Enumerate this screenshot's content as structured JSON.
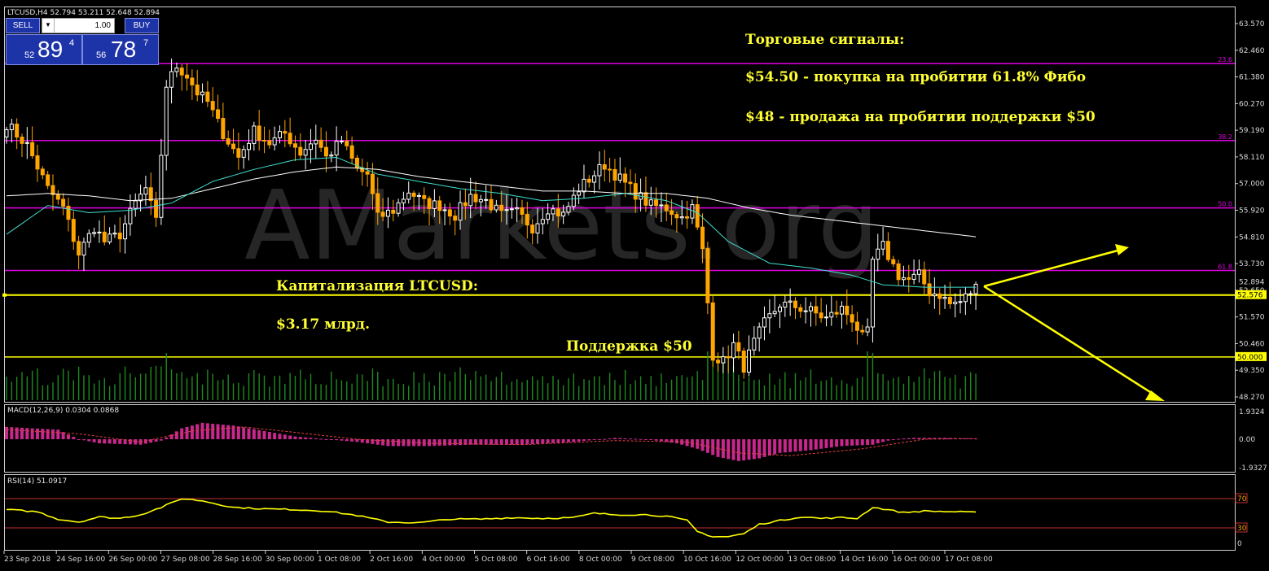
{
  "header": {
    "main": "LTCUSD,H4  52.794 53.211 52.648 52.894",
    "macd": "MACD(12,26,9) 0.0304 0.0868",
    "rsi": "RSI(14) 51.0917"
  },
  "trade_panel": {
    "sell_label": "SELL",
    "buy_label": "BUY",
    "lot": "1.00",
    "sell_prefix": "52",
    "sell_big": "89",
    "sell_sup": "4",
    "buy_prefix": "56",
    "buy_big": "78",
    "buy_sup": "7"
  },
  "watermark": "AMarkets.org",
  "annotations": {
    "signals_title": "Торговые сигналы:",
    "signal_buy": "$54.50 - покупка на пробитии 61.8% Фибо",
    "signal_sell": "$48 - продажа на пробитии поддержки $50",
    "cap_title": "Капитализация LTCUSD:",
    "cap_value": "$3.17 млрд.",
    "support": "Поддержка $50"
  },
  "colors": {
    "bull": "#ffffff",
    "bear": "#ffa500",
    "fib": "#e000e0",
    "support": "#ffff00",
    "ma_fast": "#40e0d0",
    "ma_slow": "#ffffff",
    "volume": "#1f8a1f",
    "macd": "#c8288c",
    "rsi": "#ffff00",
    "rsi_levels": "#c03030"
  },
  "chart_data": {
    "type": "candlestick",
    "symbol": "LTCUSD",
    "timeframe": "H4",
    "price_axis": {
      "ylim": [
        48.27,
        64.0
      ],
      "ticks": [
        "63.570",
        "62.460",
        "61.380",
        "60.270",
        "59.190",
        "58.110",
        "57.000",
        "55.920",
        "54.810",
        "53.730",
        "52.650",
        "51.570",
        "50.460",
        "49.350",
        "48.270"
      ],
      "current_price": "52.894",
      "line_price": "52.576",
      "support_price": "50.000"
    },
    "fibonacci": [
      {
        "label": "23.6",
        "price": 62.2
      },
      {
        "label": "38.2",
        "price": 59.0
      },
      {
        "label": "50.0",
        "price": 56.2
      },
      {
        "label": "61.8",
        "price": 53.6
      }
    ],
    "support_level": 50.0,
    "x_labels": [
      "23 Sep 2018",
      "24 Sep 16:00",
      "26 Sep 00:00",
      "27 Sep 08:00",
      "28 Sep 16:00",
      "30 Sep 00:00",
      "1 Oct 08:00",
      "2 Oct 16:00",
      "4 Oct 00:00",
      "5 Oct 08:00",
      "6 Oct 16:00",
      "8 Oct 00:00",
      "9 Oct 08:00",
      "10 Oct 16:00",
      "12 Oct 00:00",
      "13 Oct 08:00",
      "14 Oct 16:00",
      "16 Oct 00:00",
      "17 Oct 08:00"
    ],
    "close_anchors": [
      [
        0,
        59.7
      ],
      [
        4,
        58.8
      ],
      [
        8,
        57.0
      ],
      [
        11,
        56.2
      ],
      [
        14,
        54.3
      ],
      [
        17,
        55.4
      ],
      [
        19,
        54.8
      ],
      [
        22,
        55.1
      ],
      [
        25,
        56.4
      ],
      [
        27,
        57.0
      ],
      [
        29,
        55.6
      ],
      [
        31,
        61.3
      ],
      [
        33,
        62.1
      ],
      [
        35,
        61.7
      ],
      [
        37,
        61.0
      ],
      [
        39,
        60.6
      ],
      [
        42,
        59.3
      ],
      [
        45,
        58.3
      ],
      [
        48,
        59.4
      ],
      [
        51,
        58.9
      ],
      [
        54,
        59.3
      ],
      [
        57,
        58.5
      ],
      [
        60,
        59.1
      ],
      [
        62,
        58.3
      ],
      [
        65,
        59.0
      ],
      [
        68,
        57.8
      ],
      [
        70,
        57.6
      ],
      [
        72,
        55.8
      ],
      [
        75,
        56.1
      ],
      [
        78,
        56.9
      ],
      [
        81,
        56.4
      ],
      [
        84,
        56.3
      ],
      [
        87,
        55.9
      ],
      [
        90,
        56.7
      ],
      [
        93,
        56.5
      ],
      [
        96,
        55.9
      ],
      [
        99,
        56.0
      ],
      [
        102,
        55.4
      ],
      [
        105,
        56.2
      ],
      [
        108,
        55.9
      ],
      [
        111,
        57.0
      ],
      [
        114,
        57.6
      ],
      [
        116,
        58.0
      ],
      [
        119,
        57.4
      ],
      [
        122,
        56.8
      ],
      [
        125,
        56.3
      ],
      [
        128,
        56.2
      ],
      [
        131,
        55.8
      ],
      [
        133,
        56.2
      ],
      [
        135,
        54.4
      ],
      [
        137,
        50.1
      ],
      [
        139,
        49.8
      ],
      [
        141,
        50.5
      ],
      [
        143,
        49.6
      ],
      [
        145,
        50.6
      ],
      [
        147,
        51.4
      ],
      [
        150,
        52.2
      ],
      [
        153,
        52.1
      ],
      [
        156,
        51.9
      ],
      [
        159,
        51.6
      ],
      [
        162,
        52.0
      ],
      [
        164,
        51.6
      ],
      [
        166,
        50.8
      ],
      [
        167,
        51.0
      ],
      [
        168,
        54.0
      ],
      [
        170,
        54.6
      ],
      [
        173,
        53.4
      ],
      [
        175,
        53.2
      ],
      [
        177,
        53.4
      ],
      [
        179,
        52.7
      ],
      [
        181,
        52.6
      ],
      [
        183,
        52.2
      ],
      [
        185,
        52.3
      ],
      [
        186,
        52.5
      ],
      [
        188,
        52.9
      ]
    ],
    "ma_fast_anchors": [
      [
        0,
        55.1
      ],
      [
        8,
        56.3
      ],
      [
        16,
        56.0
      ],
      [
        24,
        56.1
      ],
      [
        32,
        56.4
      ],
      [
        40,
        57.3
      ],
      [
        48,
        57.8
      ],
      [
        56,
        58.2
      ],
      [
        64,
        58.3
      ],
      [
        72,
        57.6
      ],
      [
        80,
        57.3
      ],
      [
        88,
        57.0
      ],
      [
        96,
        56.8
      ],
      [
        104,
        56.5
      ],
      [
        112,
        56.6
      ],
      [
        120,
        56.8
      ],
      [
        128,
        56.5
      ],
      [
        134,
        56.0
      ],
      [
        140,
        54.8
      ],
      [
        148,
        53.9
      ],
      [
        156,
        53.7
      ],
      [
        164,
        53.4
      ],
      [
        170,
        53.0
      ],
      [
        178,
        52.9
      ],
      [
        188,
        52.9
      ]
    ],
    "ma_slow_anchors": [
      [
        0,
        56.7
      ],
      [
        8,
        56.8
      ],
      [
        16,
        56.7
      ],
      [
        24,
        56.5
      ],
      [
        32,
        56.6
      ],
      [
        40,
        57.0
      ],
      [
        48,
        57.4
      ],
      [
        56,
        57.7
      ],
      [
        64,
        57.9
      ],
      [
        72,
        57.8
      ],
      [
        80,
        57.5
      ],
      [
        88,
        57.3
      ],
      [
        96,
        57.1
      ],
      [
        104,
        56.9
      ],
      [
        112,
        56.9
      ],
      [
        120,
        56.8
      ],
      [
        128,
        56.8
      ],
      [
        136,
        56.6
      ],
      [
        144,
        56.2
      ],
      [
        152,
        55.9
      ],
      [
        160,
        55.7
      ],
      [
        168,
        55.5
      ],
      [
        176,
        55.3
      ],
      [
        188,
        55.0
      ]
    ],
    "macd": {
      "ticks": [
        "1.9324",
        "0.00",
        "-1.9327"
      ],
      "ylim": [
        -2.2,
        2.2
      ],
      "anchors": [
        [
          0,
          0.9
        ],
        [
          10,
          0.7
        ],
        [
          14,
          0.0
        ],
        [
          18,
          -0.3
        ],
        [
          26,
          -0.4
        ],
        [
          30,
          -0.1
        ],
        [
          34,
          0.8
        ],
        [
          38,
          1.2
        ],
        [
          44,
          1.0
        ],
        [
          50,
          0.6
        ],
        [
          56,
          0.2
        ],
        [
          62,
          0.0
        ],
        [
          68,
          -0.2
        ],
        [
          74,
          -0.5
        ],
        [
          82,
          -0.5
        ],
        [
          90,
          -0.4
        ],
        [
          100,
          -0.4
        ],
        [
          110,
          -0.2
        ],
        [
          118,
          0.1
        ],
        [
          124,
          0.0
        ],
        [
          130,
          -0.3
        ],
        [
          134,
          -0.7
        ],
        [
          138,
          -1.3
        ],
        [
          142,
          -1.6
        ],
        [
          146,
          -1.4
        ],
        [
          150,
          -1.0
        ],
        [
          156,
          -0.8
        ],
        [
          162,
          -0.5
        ],
        [
          168,
          -0.4
        ],
        [
          172,
          0.0
        ],
        [
          176,
          0.1
        ],
        [
          182,
          0.1
        ],
        [
          188,
          0.05
        ]
      ],
      "signal_anchors": [
        [
          0,
          0.7
        ],
        [
          14,
          0.4
        ],
        [
          26,
          -0.2
        ],
        [
          36,
          0.6
        ],
        [
          46,
          0.9
        ],
        [
          56,
          0.5
        ],
        [
          68,
          0.0
        ],
        [
          82,
          -0.3
        ],
        [
          100,
          -0.4
        ],
        [
          118,
          -0.1
        ],
        [
          132,
          -0.2
        ],
        [
          142,
          -1.0
        ],
        [
          152,
          -1.2
        ],
        [
          166,
          -0.7
        ],
        [
          178,
          0.0
        ],
        [
          188,
          0.05
        ]
      ]
    },
    "rsi": {
      "ticks": [
        "70",
        "30",
        "0"
      ],
      "ylim": [
        0,
        100
      ],
      "levels": [
        70,
        30
      ],
      "anchors": [
        [
          0,
          55
        ],
        [
          6,
          52
        ],
        [
          10,
          42
        ],
        [
          14,
          38
        ],
        [
          18,
          45
        ],
        [
          22,
          43
        ],
        [
          26,
          48
        ],
        [
          30,
          58
        ],
        [
          34,
          70
        ],
        [
          38,
          67
        ],
        [
          44,
          58
        ],
        [
          50,
          56
        ],
        [
          56,
          55
        ],
        [
          62,
          53
        ],
        [
          68,
          47
        ],
        [
          74,
          38
        ],
        [
          80,
          37
        ],
        [
          86,
          42
        ],
        [
          92,
          42
        ],
        [
          98,
          44
        ],
        [
          104,
          43
        ],
        [
          110,
          44
        ],
        [
          114,
          50
        ],
        [
          118,
          48
        ],
        [
          124,
          48
        ],
        [
          128,
          46
        ],
        [
          132,
          40
        ],
        [
          134,
          25
        ],
        [
          137,
          18
        ],
        [
          140,
          18
        ],
        [
          143,
          22
        ],
        [
          146,
          35
        ],
        [
          150,
          40
        ],
        [
          154,
          45
        ],
        [
          158,
          43
        ],
        [
          162,
          44
        ],
        [
          165,
          43
        ],
        [
          168,
          58
        ],
        [
          170,
          56
        ],
        [
          174,
          51
        ],
        [
          178,
          53
        ],
        [
          184,
          52
        ],
        [
          188,
          51
        ]
      ]
    }
  }
}
